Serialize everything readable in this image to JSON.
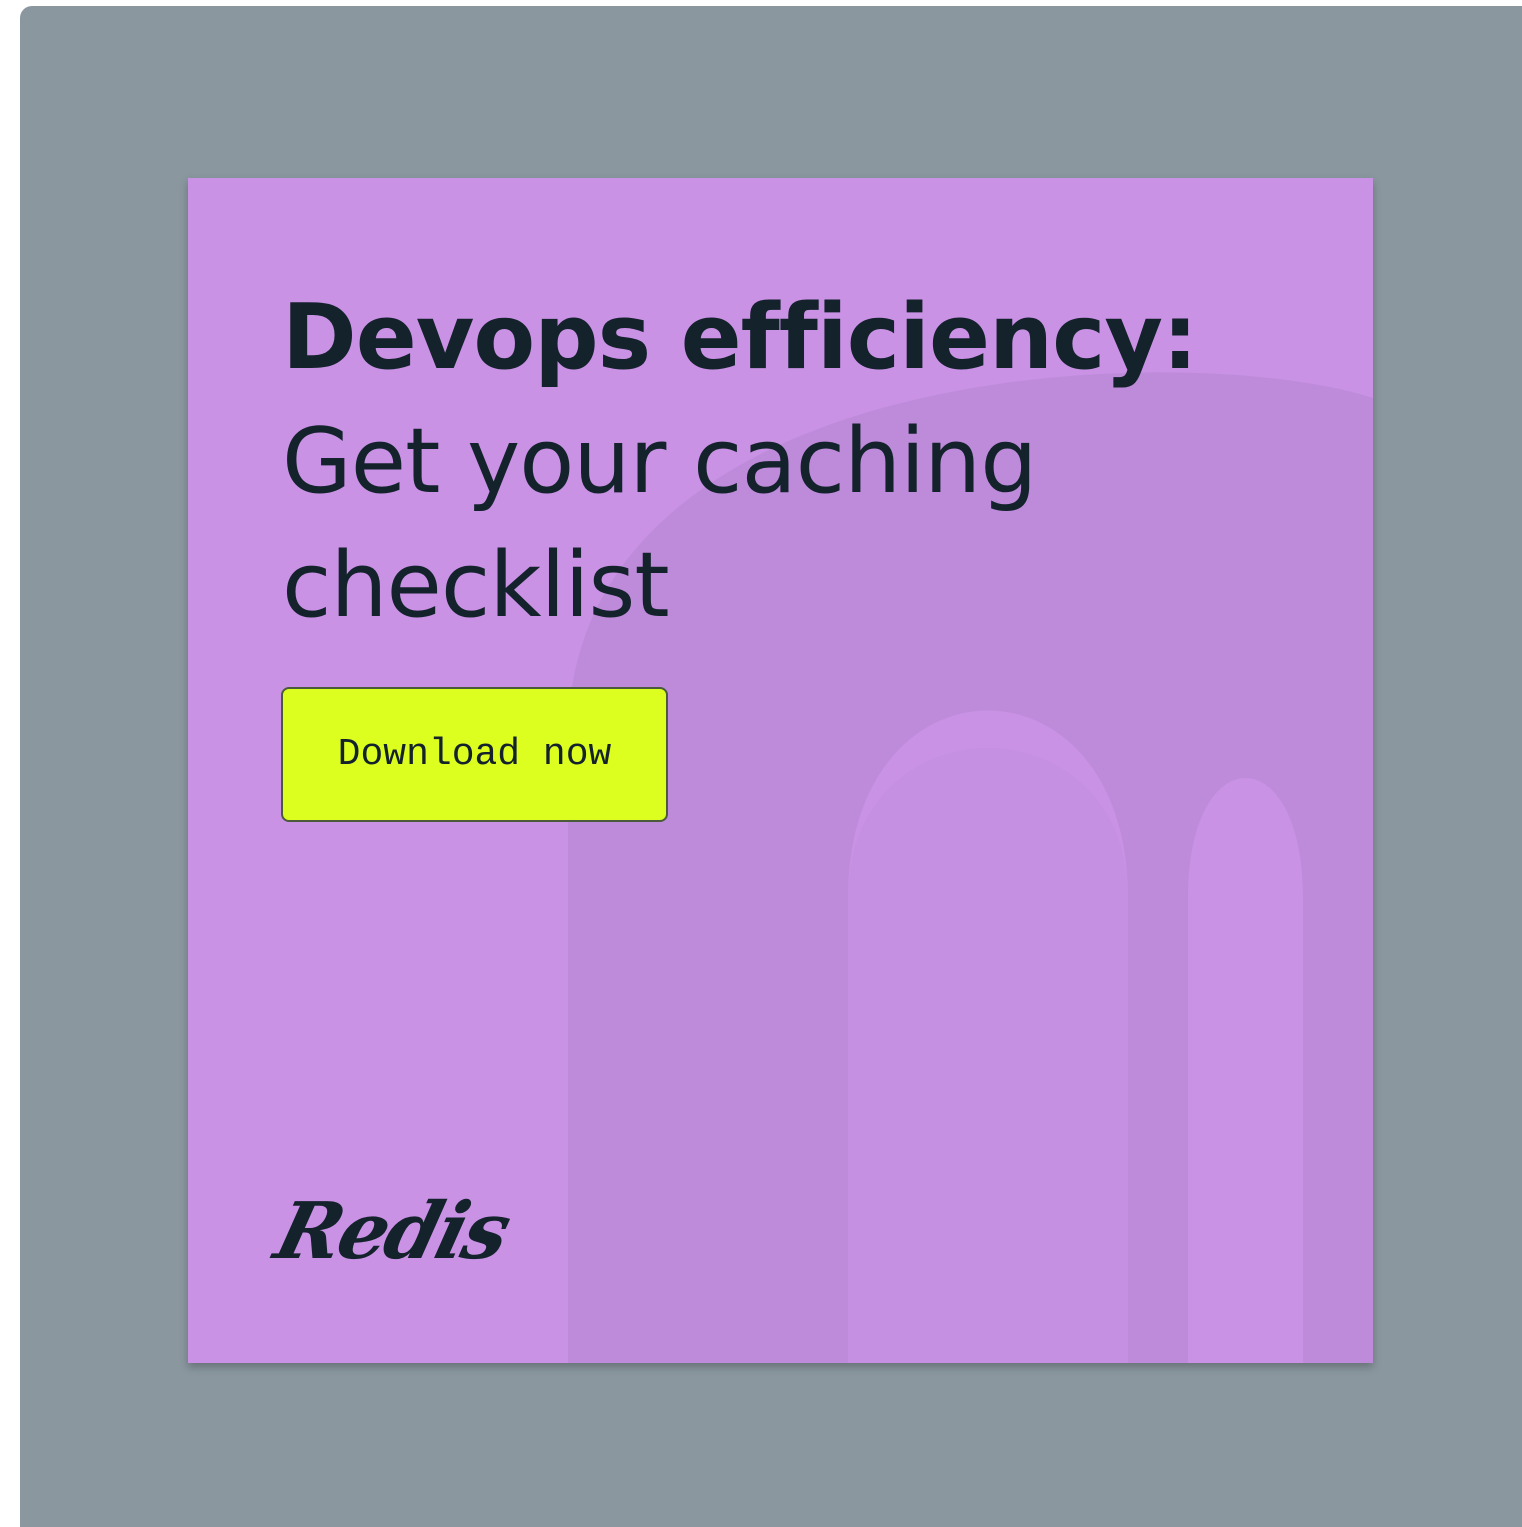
{
  "ad": {
    "headline_bold": "Devops efficiency:",
    "headline_regular": "Get your caching\nchecklist",
    "cta_label": "Download now",
    "logo_text": "Redis"
  },
  "colors": {
    "frame": "#8a979f",
    "card": "#c992e5",
    "card_shape": "#bb8ad6",
    "text": "#14222c",
    "cta": "#dcff1f"
  }
}
